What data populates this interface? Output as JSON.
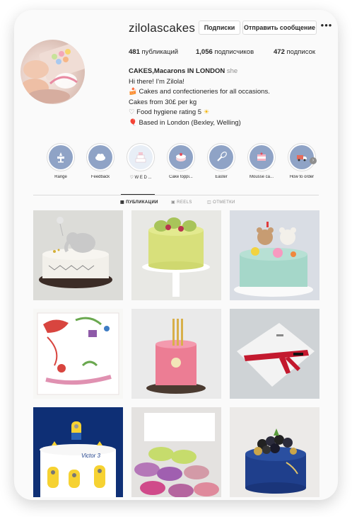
{
  "profile": {
    "username": "zilolascakes",
    "follow_label": "Подписки",
    "message_label": "Отправить сообщение",
    "more_label": "•••",
    "posts_count": "481",
    "posts_label": "публикаций",
    "followers_count": "1,056",
    "followers_label": "подписчиков",
    "following_count": "472",
    "following_label": "подписок"
  },
  "bio": {
    "name_part1": "CAKES,",
    "name_part2": "Macarons",
    "name_part3": " IN LONDON",
    "pronoun": "she",
    "line1": "Hi there! I'm Zilola!",
    "line2_emoji": "🍰",
    "line2": "Cakes and confectioneries for all occasions.",
    "line3": "Cakes from 30£ per kg",
    "line4_emoji": "♡",
    "line4": "Food hygiene rating 5",
    "line4_sun": "☀",
    "line5_emoji": "🎈",
    "line5": "Based in London (Bexley, Welling)"
  },
  "highlights": [
    {
      "label": "Range",
      "icon": "cake-stand-icon"
    },
    {
      "label": "Feedback",
      "icon": "cloud-icon"
    },
    {
      "label": "♡ W E D ...",
      "icon": "wedding-cake-icon"
    },
    {
      "label": "Cake toppi...",
      "icon": "cake-slice-icon"
    },
    {
      "label": "Easter",
      "icon": "whisk-icon"
    },
    {
      "label": "Mousse ca...",
      "icon": "layer-cake-icon"
    },
    {
      "label": "How to order",
      "icon": "delivery-van-icon"
    }
  ],
  "tabs": {
    "posts": "ПУБЛИКАЦИИ",
    "reels": "REELS",
    "tagged": "ОТМЕТКИ"
  },
  "posts": [
    {
      "name": "elephant-cake-post"
    },
    {
      "name": "macaron-pistachio-cake-post"
    },
    {
      "name": "teddy-bear-cake-post"
    },
    {
      "name": "child-drawing-cake-post"
    },
    {
      "name": "pink-candles-cake-post"
    },
    {
      "name": "kimono-belt-cake-post"
    },
    {
      "name": "minion-cake-post",
      "text": "Victor 3"
    },
    {
      "name": "macarons-post"
    },
    {
      "name": "berry-cake-post"
    }
  ],
  "colors": {
    "highlight_fill": "#8fa3c6",
    "text": "#262626",
    "muted": "#8e8e8e"
  }
}
